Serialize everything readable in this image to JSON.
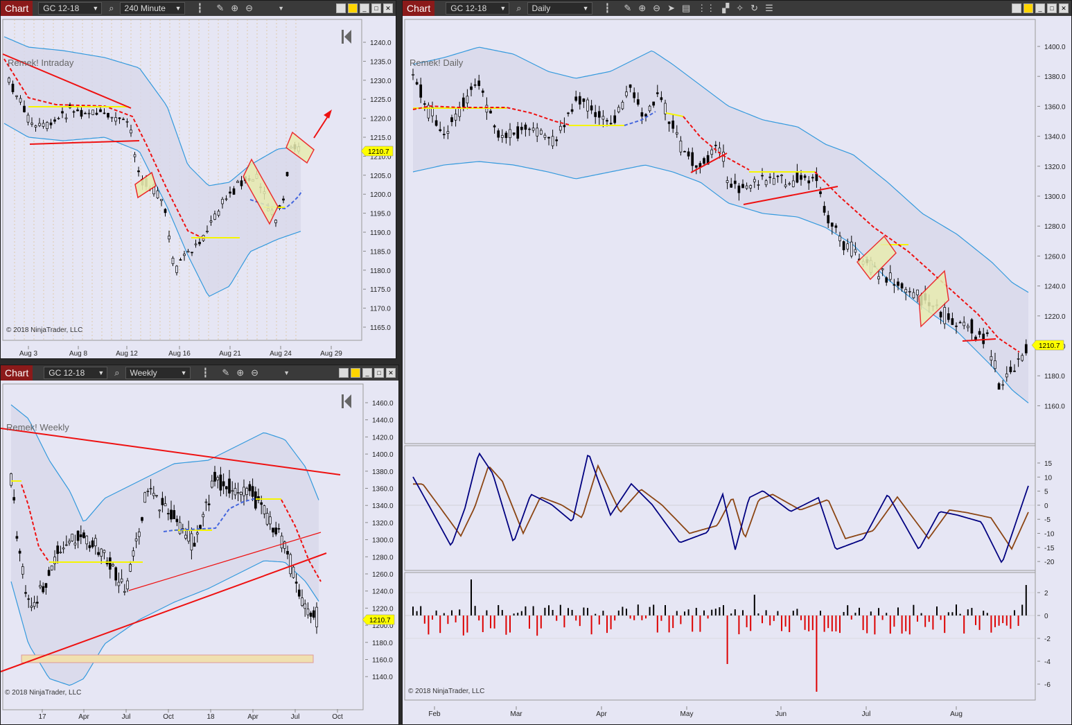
{
  "panels": {
    "intraday": {
      "chart_tag": "Chart",
      "instrument": "GC 12-18",
      "interval": "240 Minute",
      "label": "Remek! Intraday",
      "copyright": "© 2018 NinjaTrader, LLC",
      "price_marker": "1210.7",
      "y_ticks": [
        "1240.0",
        "1235.0",
        "1230.0",
        "1225.0",
        "1220.0",
        "1215.0",
        "1210.0",
        "1205.0",
        "1200.0",
        "1195.0",
        "1190.0",
        "1185.0",
        "1180.0",
        "1175.0",
        "1170.0",
        "1165.0"
      ],
      "x_ticks": [
        "Aug 3",
        "Aug 8",
        "Aug 12",
        "Aug 16",
        "Aug 21",
        "Aug 24",
        "Aug 29"
      ]
    },
    "weekly": {
      "chart_tag": "Chart",
      "instrument": "GC 12-18",
      "interval": "Weekly",
      "label": "Remek! Weekly",
      "copyright": "© 2018 NinjaTrader, LLC",
      "price_marker": "1210.7",
      "y_ticks": [
        "1460.0",
        "1440.0",
        "1420.0",
        "1400.0",
        "1380.0",
        "1360.0",
        "1340.0",
        "1320.0",
        "1300.0",
        "1280.0",
        "1260.0",
        "1240.0",
        "1220.0",
        "1200.0",
        "1180.0",
        "1160.0",
        "1140.0"
      ],
      "x_ticks": [
        "17",
        "Apr",
        "Jul",
        "Oct",
        "18",
        "Apr",
        "Jul",
        "Oct"
      ]
    },
    "daily": {
      "chart_tag": "Chart",
      "instrument": "GC 12-18",
      "interval": "Daily",
      "label": "Remek! Daily",
      "copyright": "© 2018 NinjaTrader, LLC",
      "price_marker": "1210.7",
      "y_ticks": [
        "1400.0",
        "1380.0",
        "1360.0",
        "1340.0",
        "1320.0",
        "1300.0",
        "1280.0",
        "1260.0",
        "1240.0",
        "1220.0",
        "1200.0",
        "1180.0",
        "1160.0"
      ],
      "osc_ticks": [
        "15",
        "10",
        "5",
        "0",
        "-5",
        "-10",
        "-15",
        "-20"
      ],
      "hist_ticks": [
        "2",
        "0",
        "-2",
        "-4",
        "-6"
      ],
      "x_ticks": [
        "Feb",
        "Mar",
        "Apr",
        "May",
        "Jun",
        "Jul",
        "Aug"
      ]
    }
  },
  "colors": {
    "band_fill": "#d8d8ea",
    "band_line": "#3399dd",
    "trend_red": "#ee1111",
    "signal_yellow": "#f5f500",
    "dash_blue": "#4466dd",
    "osc_blue": "#000080",
    "osc_brown": "#8b4513",
    "panel_bg": "#e6e6f4",
    "chart_tag": "#8b1a1a",
    "marker": "#ffff00"
  }
}
